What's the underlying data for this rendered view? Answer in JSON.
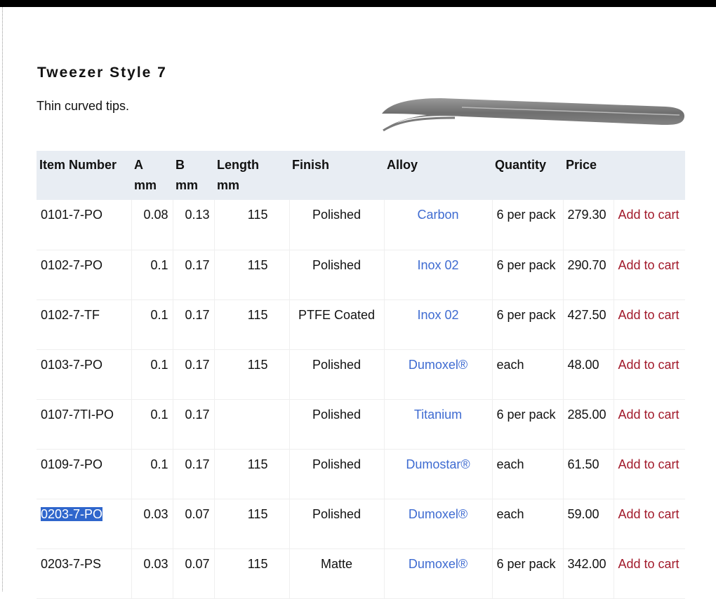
{
  "product": {
    "title": "Tweezer Style 7",
    "description": "Thin curved tips."
  },
  "table": {
    "headers": {
      "item": "Item Number",
      "a": "A",
      "a_unit": "mm",
      "b": "B",
      "b_unit": "mm",
      "length": "Length",
      "length_unit": "mm",
      "finish": "Finish",
      "alloy": "Alloy",
      "quantity": "Quantity",
      "price": "Price"
    },
    "add_to_cart": "Add to cart",
    "rows": [
      {
        "item": "0101-7-PO",
        "a": "0.08",
        "b": "0.13",
        "length": "115",
        "finish": "Polished",
        "alloy": "Carbon",
        "quantity": "6 per pack",
        "price": "279.30"
      },
      {
        "item": "0102-7-PO",
        "a": "0.1",
        "b": "0.17",
        "length": "115",
        "finish": "Polished",
        "alloy": "Inox 02",
        "quantity": "6 per pack",
        "price": "290.70"
      },
      {
        "item": "0102-7-TF",
        "a": "0.1",
        "b": "0.17",
        "length": "115",
        "finish": "PTFE Coated",
        "alloy": "Inox 02",
        "quantity": "6 per pack",
        "price": "427.50"
      },
      {
        "item": "0103-7-PO",
        "a": "0.1",
        "b": "0.17",
        "length": "115",
        "finish": "Polished",
        "alloy": "Dumoxel®",
        "quantity": "each",
        "price": "48.00"
      },
      {
        "item": "0107-7TI-PO",
        "a": "0.1",
        "b": "0.17",
        "length": "",
        "finish": "Polished",
        "alloy": "Titanium",
        "quantity": "6 per pack",
        "price": "285.00"
      },
      {
        "item": "0109-7-PO",
        "a": "0.1",
        "b": "0.17",
        "length": "115",
        "finish": "Polished",
        "alloy": "Dumostar®",
        "quantity": "each",
        "price": "61.50"
      },
      {
        "item": "0203-7-PO",
        "a": "0.03",
        "b": "0.07",
        "length": "115",
        "finish": "Polished",
        "alloy": "Dumoxel®",
        "quantity": "each",
        "price": "59.00"
      },
      {
        "item": "0203-7-PS",
        "a": "0.03",
        "b": "0.07",
        "length": "115",
        "finish": "Matte",
        "alloy": "Dumoxel®",
        "quantity": "6 per pack",
        "price": "342.00"
      }
    ]
  },
  "selection": {
    "selected_row": 6
  },
  "colors": {
    "header_bg": "#e8edf3",
    "alloy_link": "#3e6bd1",
    "cart_link": "#a21a2b",
    "selection": "#2f66cc"
  },
  "icons": {
    "product_image": "curved-tweezer-image"
  }
}
